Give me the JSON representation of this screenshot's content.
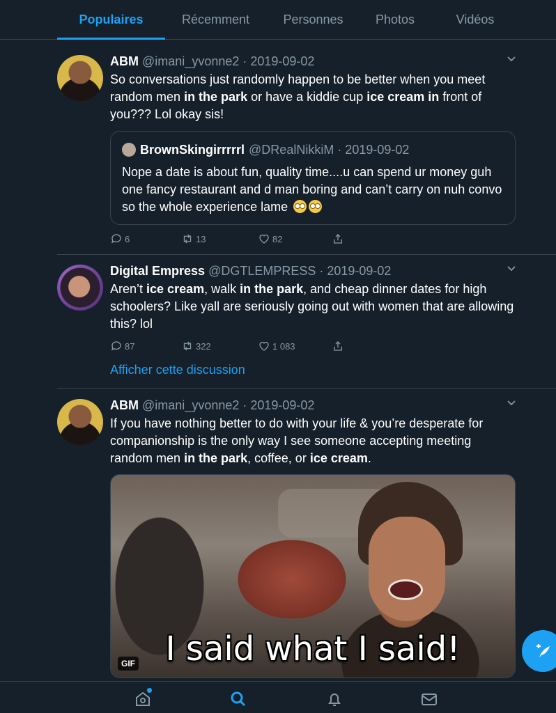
{
  "tabs": [
    {
      "label": "Populaires",
      "active": true
    },
    {
      "label": "Récemment",
      "active": false
    },
    {
      "label": "Personnes",
      "active": false
    },
    {
      "label": "Photos",
      "active": false
    },
    {
      "label": "Vidéos",
      "active": false
    }
  ],
  "tweets": [
    {
      "name": "ABM",
      "meta": "@imani_yvonne2 · 2019-09-02",
      "text_parts": [
        "So conversations just randomly happen to be better when you meet random men ",
        "in the park",
        " or have a kiddie cup ",
        "ice cream in",
        " front of you??? Lol okay sis!"
      ],
      "quote": {
        "name": "BrownSkingirrrrrl",
        "meta": "@DRealNikkiM · 2019-09-02",
        "text": "Nope a date is about fun, quality time....u can spend ur money guh one fancy restaurant and d man boring and can’t carry on nuh convo so the whole experience lame",
        "emojis": [
          "face-with-rolling-eyes",
          "face-with-rolling-eyes"
        ]
      },
      "replies": "6",
      "retweets": "13",
      "likes": "82"
    },
    {
      "name": "Digital Empress",
      "meta": "@DGTLEMPRESS · 2019-09-02",
      "text_parts": [
        "Aren’t ",
        "ice cream",
        ", walk ",
        "in the park",
        ", and cheap dinner dates for high schoolers? Like yall are seriously going out with women that are allowing this? lol"
      ],
      "replies": "87",
      "retweets": "322",
      "likes": "1 083",
      "thread_link": "Afficher cette discussion"
    },
    {
      "name": "ABM",
      "meta": "@imani_yvonne2 · 2019-09-02",
      "text_parts": [
        "If you have nothing better to do with your life & you’re desperate for companionship is the only way I see someone accepting meeting random men ",
        "in the park",
        ", coffee, or ",
        "ice cream",
        "."
      ],
      "media": {
        "caption": "I said what I said!",
        "badge": "GIF"
      }
    }
  ],
  "icons": {
    "reply": "reply-icon",
    "retweet": "retweet-icon",
    "like": "heart-icon",
    "share": "share-icon",
    "compose": "compose-icon",
    "home": "home-icon",
    "search": "search-icon",
    "notifications": "bell-icon",
    "messages": "mail-icon"
  },
  "colors": {
    "background": "#15202b",
    "accent": "#1da1f2",
    "secondary_text": "#8899a6",
    "border": "#38444d"
  }
}
